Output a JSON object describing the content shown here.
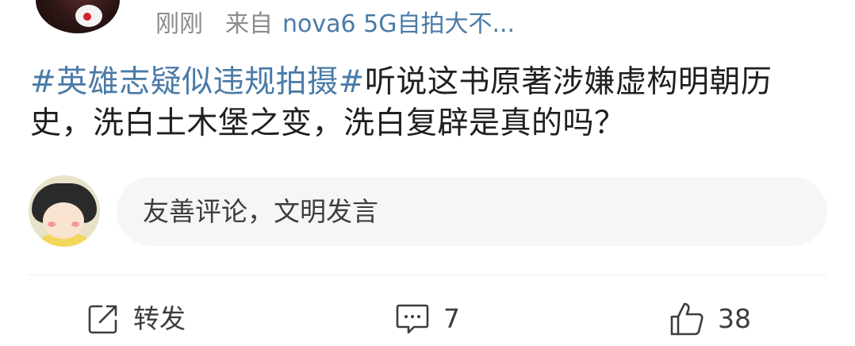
{
  "post": {
    "meta": {
      "time": "刚刚",
      "from_label": "来自",
      "device": "nova6 5G自拍大不..."
    },
    "topic": "#英雄志疑似违规拍摄#",
    "text": "听说这书原著涉嫌虚构明朝历史，洗白土木堡之变，洗白复辟是真的吗？"
  },
  "comment": {
    "placeholder": "友善评论，文明发言"
  },
  "actions": {
    "repost": {
      "label": "转发",
      "icon": "share-icon"
    },
    "comment": {
      "count": "7",
      "icon": "comment-icon"
    },
    "like": {
      "count": "38",
      "icon": "thumbs-up-icon"
    }
  },
  "colors": {
    "link": "#4a7aa8",
    "meta": "#8b8b8b",
    "text": "#1f1f1f",
    "input_bg": "#f6f6f6"
  }
}
